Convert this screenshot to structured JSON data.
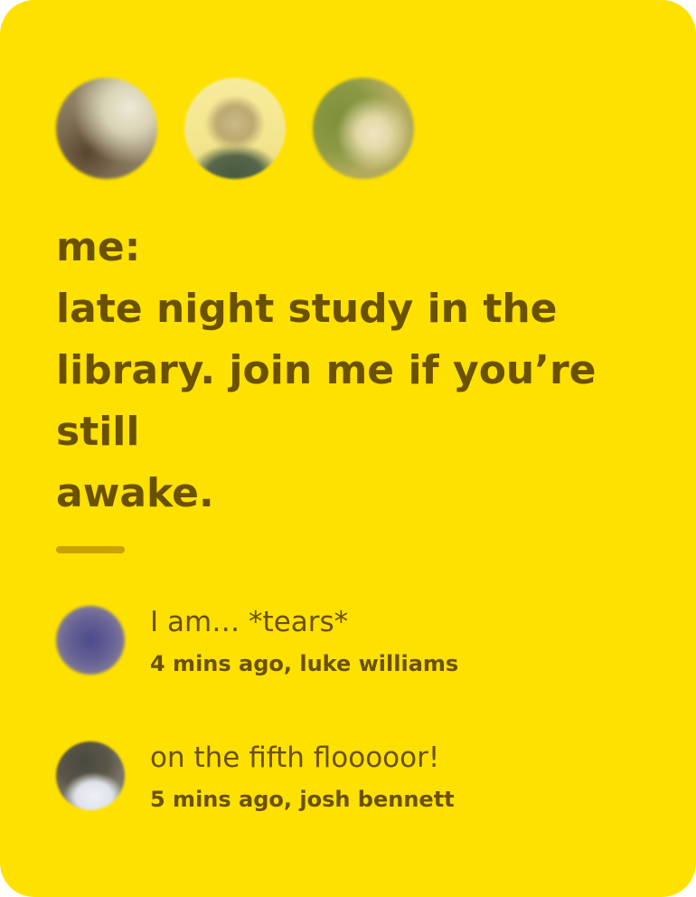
{
  "post": {
    "author_label": "me:",
    "message_lines": [
      "late night study in the",
      "library. join me if you’re",
      "still",
      "awake."
    ]
  },
  "participants": [
    {
      "icon": "participant-avatar-1"
    },
    {
      "icon": "participant-avatar-2"
    },
    {
      "icon": "participant-avatar-3"
    }
  ],
  "comments": [
    {
      "text": "I am… *tears*",
      "meta": "4 mins ago, luke williams"
    },
    {
      "text": "on the fifth flooooor!",
      "meta": "5 mins ago, josh bennett"
    }
  ],
  "colors": {
    "card_background": "#FFE100",
    "text": "#6A5100",
    "divider": "#C9A100"
  }
}
